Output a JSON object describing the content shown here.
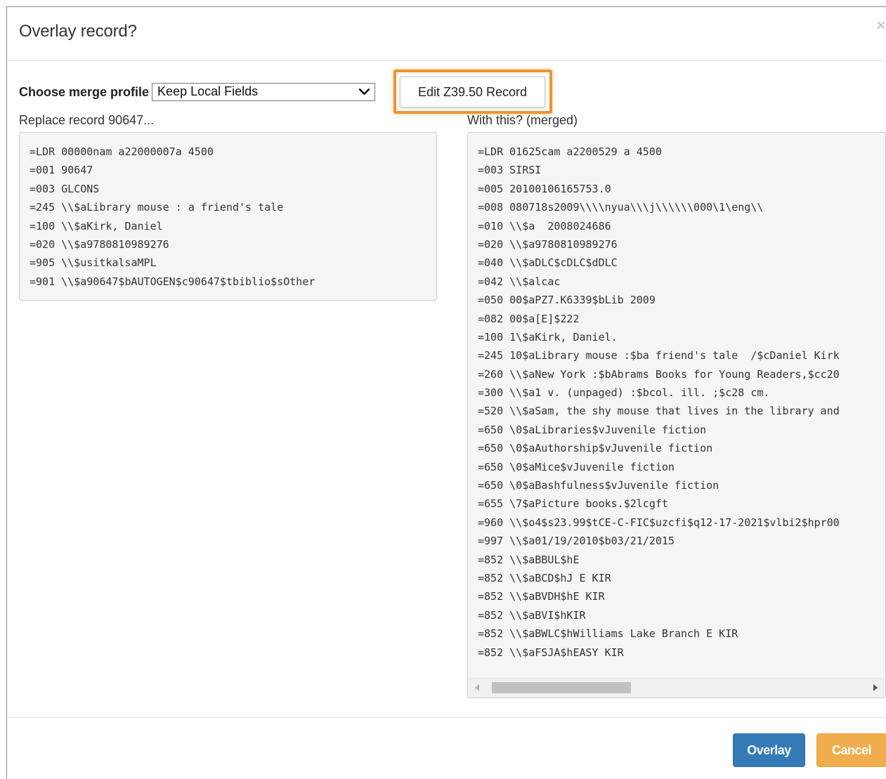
{
  "dialog": {
    "title": "Overlay record?",
    "close_glyph": "×"
  },
  "merge_profile": {
    "label": "Choose merge profile",
    "selected": "Keep Local Fields"
  },
  "edit_button_label": "Edit Z39.50 Record",
  "left_column": {
    "caption": "Replace record 90647...",
    "lines": [
      "=LDR 00000nam a22000007a 4500",
      "=001 90647",
      "=003 GLCONS",
      "=245 \\\\$aLibrary mouse : a friend's tale",
      "=100 \\\\$aKirk, Daniel",
      "=020 \\\\$a9780810989276",
      "=905 \\\\$usitkalsaMPL",
      "=901 \\\\$a90647$bAUTOGEN$c90647$tbiblio$sOther"
    ]
  },
  "right_column": {
    "caption": "With this? (merged)",
    "lines": [
      "=LDR 01625cam a2200529 a 4500",
      "=003 SIRSI",
      "=005 20100106165753.0",
      "=008 080718s2009\\\\\\\\nyua\\\\\\j\\\\\\\\\\\\000\\1\\eng\\\\",
      "=010 \\\\$a  2008024686",
      "=020 \\\\$a9780810989276",
      "=040 \\\\$aDLC$cDLC$dDLC",
      "=042 \\\\$alcac",
      "=050 00$aPZ7.K6339$bLib 2009",
      "=082 00$a[E]$222",
      "=100 1\\$aKirk, Daniel.",
      "=245 10$aLibrary mouse :$ba friend's tale  /$cDaniel Kirk",
      "=260 \\\\$aNew York :$bAbrams Books for Young Readers,$cc20",
      "=300 \\\\$a1 v. (unpaged) :$bcol. ill. ;$c28 cm.",
      "=520 \\\\$aSam, the shy mouse that lives in the library and",
      "=650 \\0$aLibraries$vJuvenile fiction",
      "=650 \\0$aAuthorship$vJuvenile fiction",
      "=650 \\0$aMice$vJuvenile fiction",
      "=650 \\0$aBashfulness$vJuvenile fiction",
      "=655 \\7$aPicture books.$2lcgft",
      "=960 \\\\$o4$s23.99$tCE-C-FIC$uzcfi$q12-17-2021$vlbi2$hpr00",
      "=997 \\\\$a01/19/2010$b03/21/2015",
      "=852 \\\\$aBBUL$hE",
      "=852 \\\\$aBCD$hJ E KIR",
      "=852 \\\\$aBVDH$hE KIR",
      "=852 \\\\$aBVI$hKIR",
      "=852 \\\\$aBWLC$hWilliams Lake Branch E KIR",
      "=852 \\\\$aFSJA$hEASY KIR"
    ]
  },
  "buttons": {
    "overlay": "Overlay",
    "cancel": "Cancel"
  },
  "colors": {
    "highlight": "#f0932e",
    "primary": "#337ab7",
    "warning": "#f0ad4e"
  }
}
